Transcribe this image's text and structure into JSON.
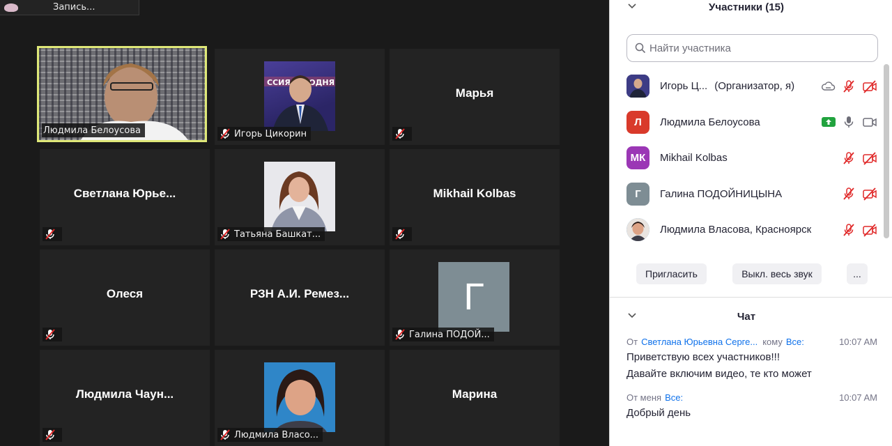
{
  "recording": {
    "label": "Запись..."
  },
  "tiles": [
    {
      "name": "Людмила Белоусова",
      "label": "Людмила Белоусова"
    },
    {
      "name": "Игорь Цикорин",
      "label": "Игорь Цикорин"
    },
    {
      "name": "Марья",
      "label": ""
    },
    {
      "name": "Светлана  Юрье...",
      "label": ""
    },
    {
      "name": "Татьяна Башкат...",
      "label": "Татьяна Башкат..."
    },
    {
      "name": "Mikhail Kolbas",
      "label": ""
    },
    {
      "name": "Олеся",
      "label": ""
    },
    {
      "name": "РЗН А.И. Ремез...",
      "label": ""
    },
    {
      "name": "Галина ПОДОЙ...",
      "label": "Галина ПОДОЙ...",
      "avatar_letter": "Г"
    },
    {
      "name": "Людмила  Чаун...",
      "label": ""
    },
    {
      "name": "Людмила Власо...",
      "label": "Людмила Власо..."
    },
    {
      "name": "Марина",
      "label": ""
    }
  ],
  "participants": {
    "title": "Участники (15)",
    "search_placeholder": "Найти участника",
    "list": [
      {
        "name": "Игорь Ц...",
        "role": "(Организатор, я)",
        "avatar": "photo"
      },
      {
        "name": "Людмила Белоусова",
        "avatar": "Л",
        "avatar_color": "#d93a2b"
      },
      {
        "name": "Mikhail Kolbas",
        "avatar": "МК",
        "avatar_color": "#9b37b5"
      },
      {
        "name": "Галина ПОДОЙНИЦЫНА",
        "avatar": "Г",
        "avatar_color": "#7e8d94"
      },
      {
        "name": "Людмила Власова, Красноярск",
        "avatar": "photo"
      }
    ],
    "buttons": {
      "invite": "Пригласить",
      "mute_all": "Выкл. весь звук",
      "more": "..."
    }
  },
  "chat": {
    "title": "Чат",
    "messages": [
      {
        "from_label": "От",
        "from": "Светлана Юрьевна Серге...",
        "to_label": "кому",
        "to": "Все:",
        "time": "10:07 AM",
        "lines": [
          "Приветствую всех участников!!!",
          "Давайте включим видео, те кто может"
        ]
      },
      {
        "from_label": "От меня",
        "from": "",
        "to_label": "",
        "to": "Все:",
        "time": "10:07 AM",
        "lines": [
          "Добрый день"
        ]
      }
    ]
  },
  "colors": {
    "active_speaker": "#dfe878",
    "mute_red": "#e02828",
    "share_green": "#21a33e",
    "link_blue": "#0e71eb"
  }
}
